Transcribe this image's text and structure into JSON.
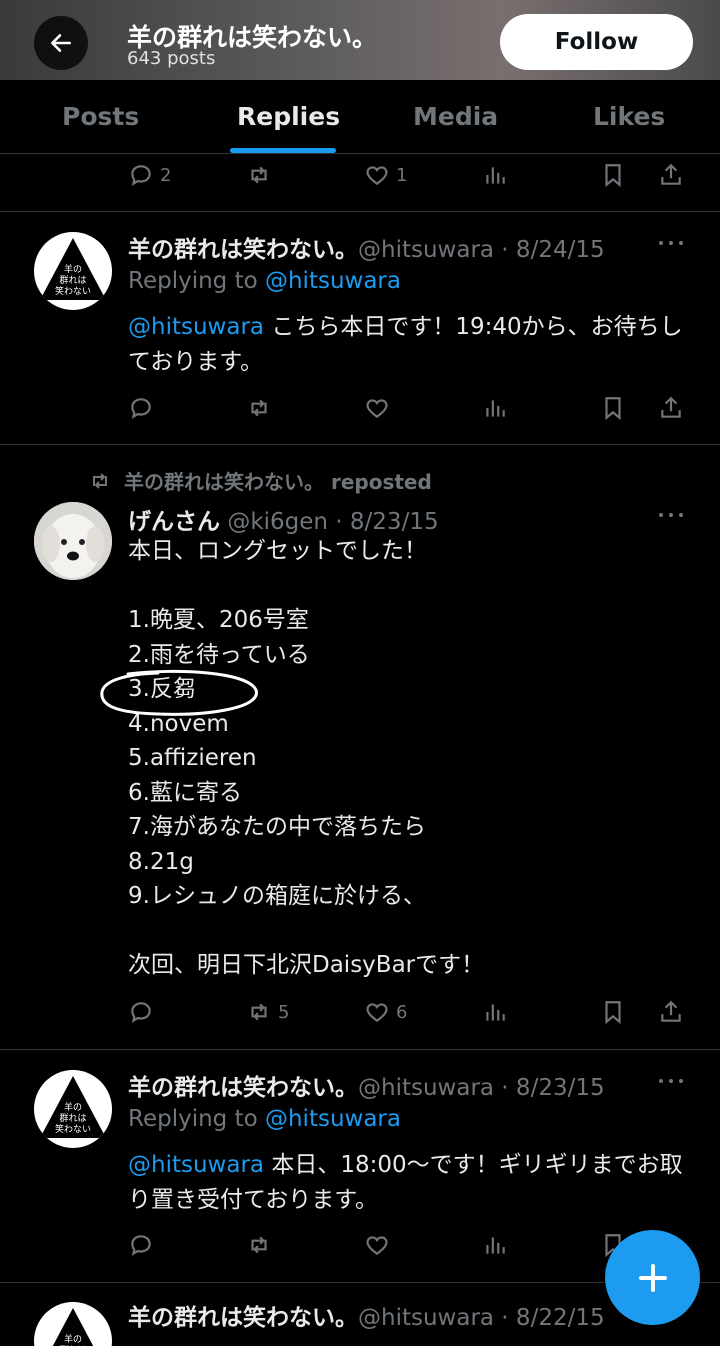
{
  "header": {
    "title": "羊の群れは笑わない。",
    "posts_count": "643 posts",
    "follow_label": "Follow"
  },
  "tabs": [
    {
      "label": "Posts"
    },
    {
      "label": "Replies"
    },
    {
      "label": "Media"
    },
    {
      "label": "Likes"
    }
  ],
  "top_actions": {
    "replies": "2",
    "reposts": "",
    "likes": "1"
  },
  "tweet1": {
    "name": "羊の群れは笑わない。",
    "meta": "@hitsuwara · 8/24/15",
    "replying_label": "Replying to",
    "replying_to": "@hitsuwara",
    "mention": "@hitsuwara",
    "text": " こちら本日です！19:40から、お待ちしております。"
  },
  "tweet2": {
    "repost_label": "羊の群れは笑わない。 reposted",
    "name": "げんさん",
    "meta": "@ki6gen · 8/23/15",
    "text": "本日、ロングセットでした！\n\n1.晩夏、206号室\n2.雨を待っている\n3.反芻\n4.novem\n5.affizieren\n6.藍に寄る\n7.海があなたの中で落ちたら\n8.21g\n9.レシュノの箱庭に於ける、\n\n次回、明日下北沢DaisyBarです！",
    "reposts": "5",
    "likes": "6"
  },
  "tweet3": {
    "name": "羊の群れは笑わない。",
    "meta": "@hitsuwara · 8/23/15",
    "replying_label": "Replying to",
    "replying_to": "@hitsuwara",
    "mention": "@hitsuwara",
    "text": " 本日、18:00〜です！ギリギリまでお取り置き受付ております。"
  },
  "tweet4": {
    "name": "羊の群れは笑わない。",
    "meta": "@hitsuwara · 8/22/15"
  },
  "avatar_text": "羊の\n群れは\n笑わない",
  "colors": {
    "accent": "#1d9bf0",
    "background": "#000000",
    "muted": "#71767b"
  }
}
